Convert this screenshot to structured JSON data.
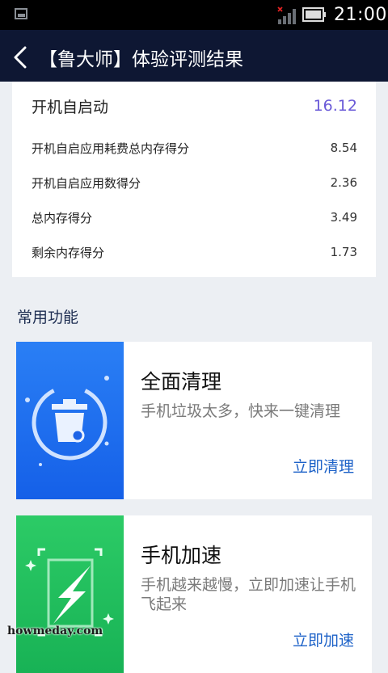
{
  "status_bar": {
    "time": "21:00"
  },
  "header": {
    "title": "【鲁大师】体验评测结果"
  },
  "score_card": {
    "main": {
      "label": "开机自启动",
      "value": "16.12"
    },
    "items": [
      {
        "label": "开机自启应用耗费总内存得分",
        "value": "8.54"
      },
      {
        "label": "开机自启应用数得分",
        "value": "2.36"
      },
      {
        "label": "总内存得分",
        "value": "3.49"
      },
      {
        "label": "剩余内存得分",
        "value": "1.73"
      }
    ]
  },
  "common_section": {
    "title": "常用功能",
    "cards": [
      {
        "title": "全面清理",
        "desc": "手机垃圾太多，快来一键清理",
        "action": "立即清理",
        "icon": "trash-cleanup-icon",
        "color": "#1e6ff0"
      },
      {
        "title": "手机加速",
        "desc": "手机越来越慢，立即加速让手机飞起来",
        "action": "立即加速",
        "icon": "lightning-boost-icon",
        "color": "#20bd5c"
      }
    ]
  },
  "watermark": "howmeday.com"
}
